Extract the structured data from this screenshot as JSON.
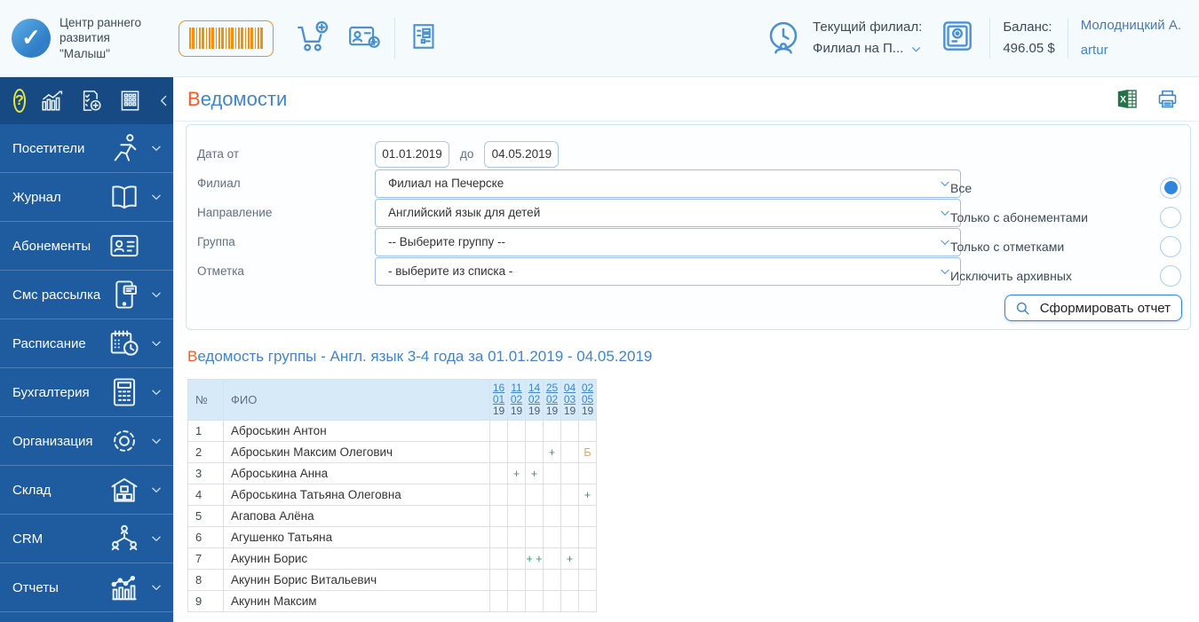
{
  "header": {
    "app_name": "Центр раннего развития \"Малыш\"",
    "current_branch_label": "Текущий филиал:",
    "current_branch_value": "Филиал на П...",
    "balance_label": "Баланс:",
    "balance_value": "496.05 $",
    "user_name": "Молодницкий А.",
    "user_login": "artur"
  },
  "sidebar": {
    "items": [
      {
        "id": "visitors",
        "label": "Посетители",
        "icon": "running-person-icon",
        "chevron": true
      },
      {
        "id": "journal",
        "label": "Журнал",
        "icon": "open-book-icon",
        "chevron": true
      },
      {
        "id": "subscriptions",
        "label": "Абонементы",
        "icon": "id-card-icon",
        "chevron": false
      },
      {
        "id": "sms",
        "label": "Смс рассылка",
        "icon": "phone-message-icon",
        "chevron": true
      },
      {
        "id": "schedule",
        "label": "Расписание",
        "icon": "calendar-clock-icon",
        "chevron": true
      },
      {
        "id": "accounting",
        "label": "Бухгалтерия",
        "icon": "calculator-icon",
        "chevron": true
      },
      {
        "id": "organization",
        "label": "Организация",
        "icon": "gear-icon",
        "chevron": true
      },
      {
        "id": "warehouse",
        "label": "Склад",
        "icon": "warehouse-icon",
        "chevron": true
      },
      {
        "id": "crm",
        "label": "CRM",
        "icon": "people-network-icon",
        "chevron": true
      },
      {
        "id": "reports",
        "label": "Отчеты",
        "icon": "line-bar-chart-icon",
        "chevron": true
      }
    ]
  },
  "page": {
    "title_first": "В",
    "title_rest": "едомости"
  },
  "filters": {
    "date_label": "Дата от",
    "date_to_label": "до",
    "date_from": "01.01.2019",
    "date_to": "04.05.2019",
    "branch_label": "Филиал",
    "branch_value": "Филиал на Печерске",
    "direction_label": "Направление",
    "direction_value": "Английский язык для детей",
    "group_label": "Группа",
    "group_value": "-- Выберите группу --",
    "mark_label": "Отметка",
    "mark_value": "- выберите из списка -",
    "radios": [
      {
        "label": "Все",
        "selected": true
      },
      {
        "label": "Только с абонементами",
        "selected": false
      },
      {
        "label": "Только с отметками",
        "selected": false
      },
      {
        "label": "Исключить архивных",
        "selected": false
      }
    ],
    "submit_label": "Сформировать отчет"
  },
  "report": {
    "title_first": "В",
    "title_rest": "едомость группы - Англ. язык 3-4 года за 01.01.2019 - 04.05.2019",
    "table": {
      "num_header": "№",
      "name_header": "ФИО",
      "date_columns": [
        {
          "day": "16",
          "month": "01",
          "year": "19"
        },
        {
          "day": "11",
          "month": "02",
          "year": "19"
        },
        {
          "day": "14",
          "month": "02",
          "year": "19"
        },
        {
          "day": "25",
          "month": "02",
          "year": "19"
        },
        {
          "day": "04",
          "month": "03",
          "year": "19"
        },
        {
          "day": "02",
          "month": "05",
          "year": "19"
        }
      ],
      "rows": [
        {
          "num": "1",
          "name": "Аброськин Антон",
          "marks": [
            "",
            "",
            "",
            "",
            "",
            ""
          ]
        },
        {
          "num": "2",
          "name": "Аброськин Максим Олегович",
          "marks": [
            "",
            "",
            "",
            "+",
            "",
            "Б"
          ]
        },
        {
          "num": "3",
          "name": "Аброськина Анна",
          "marks": [
            "",
            "+",
            "+",
            "",
            "",
            ""
          ]
        },
        {
          "num": "4",
          "name": "Аброськина Татьяна Олеговна",
          "marks": [
            "",
            "",
            "",
            "",
            "",
            "+"
          ]
        },
        {
          "num": "5",
          "name": "Агапова Алёна",
          "marks": [
            "",
            "",
            "",
            "",
            "",
            ""
          ]
        },
        {
          "num": "6",
          "name": "Агушенко Татьяна",
          "marks": [
            "",
            "",
            "",
            "",
            "",
            ""
          ]
        },
        {
          "num": "7",
          "name": "Акунин Борис",
          "marks": [
            "",
            "",
            "+ +",
            "",
            "+",
            ""
          ]
        },
        {
          "num": "8",
          "name": "Акунин Борис Витальевич",
          "marks": [
            "",
            "",
            "",
            "",
            "",
            ""
          ]
        },
        {
          "num": "9",
          "name": "Акунин Максим",
          "marks": [
            "",
            "",
            "",
            "",
            "",
            ""
          ]
        }
      ]
    }
  },
  "colors": {
    "accent_orange": "#f29111",
    "accent_blue": "#3e86c8",
    "sidebar_blue": "#1e5b9f",
    "title_letter_orange": "#ff5a1e",
    "mark_green": "#27a06b",
    "mark_orange": "#f2a33c",
    "radio_selected_blue": "#2e86de",
    "excel_green": "#217346"
  }
}
